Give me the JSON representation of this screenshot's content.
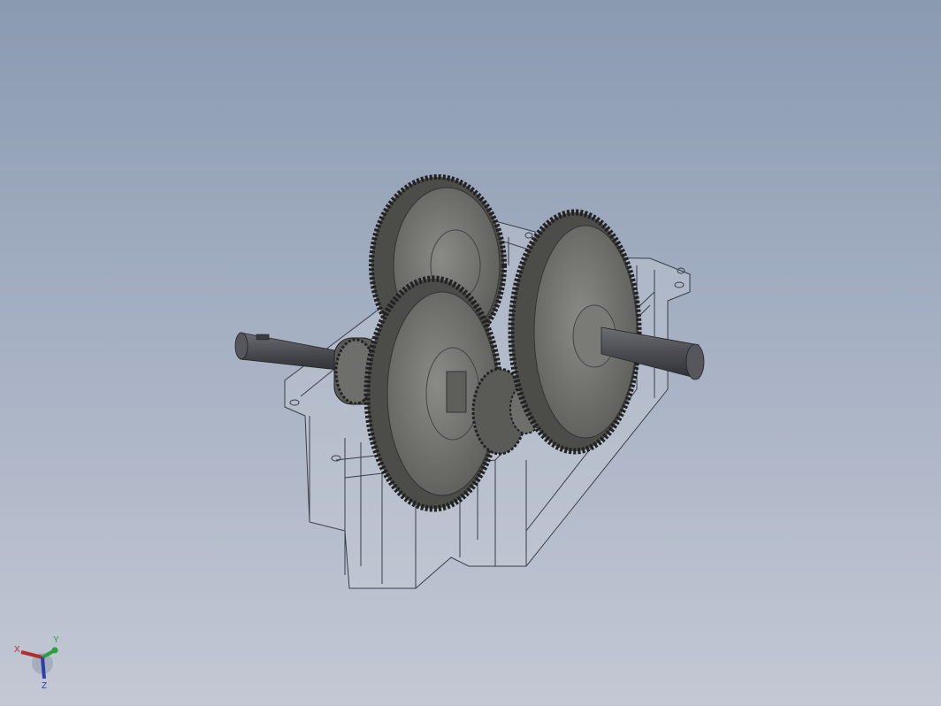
{
  "viewport": {
    "background_top": "#8a9ab0",
    "background_bottom": "#c4c8d4"
  },
  "model": {
    "housing_color": "#b8c0cc",
    "gear_color": "#6a6a66",
    "shaft_color": "#4e5056"
  },
  "triad": {
    "x_label": "X",
    "y_label": "Y",
    "z_label": "Z",
    "x_color": "#b03030",
    "y_color": "#2aa040",
    "z_color": "#2a40a8"
  }
}
